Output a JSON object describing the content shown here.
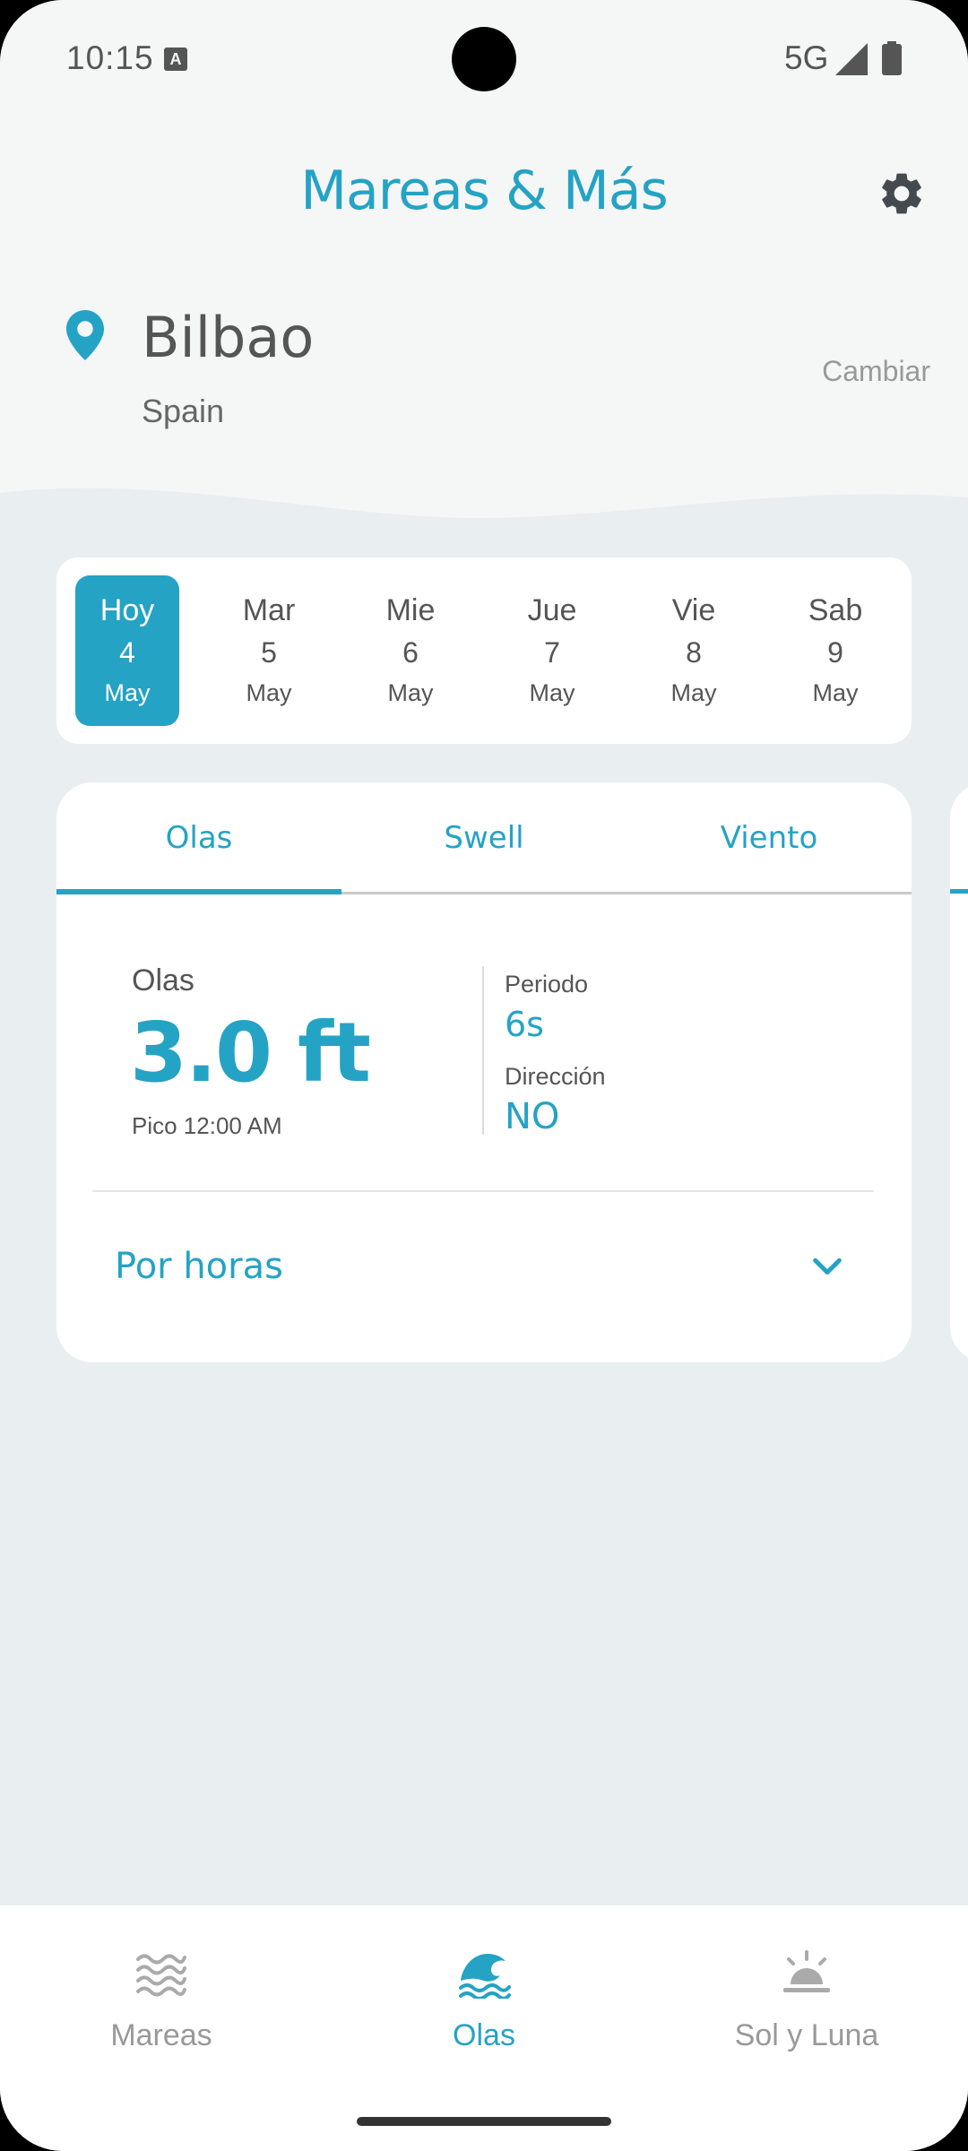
{
  "status_bar": {
    "time": "10:15",
    "network": "5G"
  },
  "header": {
    "title": "Mareas & Más"
  },
  "location": {
    "city": "Bilbao",
    "country": "Spain",
    "change_label": "Cambiar"
  },
  "dates": [
    {
      "day": "Hoy",
      "num": "4",
      "month": "May",
      "active": true
    },
    {
      "day": "Mar",
      "num": "5",
      "month": "May"
    },
    {
      "day": "Mie",
      "num": "6",
      "month": "May"
    },
    {
      "day": "Jue",
      "num": "7",
      "month": "May"
    },
    {
      "day": "Vie",
      "num": "8",
      "month": "May"
    },
    {
      "day": "Sab",
      "num": "9",
      "month": "May"
    }
  ],
  "tabs": [
    {
      "label": "Olas",
      "active": true
    },
    {
      "label": "Swell"
    },
    {
      "label": "Viento"
    }
  ],
  "waves": {
    "label": "Olas",
    "height": "3.0 ft",
    "peak": "Pico 12:00 AM",
    "period_label": "Periodo",
    "period_value": "6s",
    "direction_label": "Dirección",
    "direction_value": "NO",
    "hourly_label": "Por horas"
  },
  "bottom_nav": [
    {
      "label": "Mareas",
      "icon": "waves-icon"
    },
    {
      "label": "Olas",
      "icon": "breaking-wave-icon",
      "active": true
    },
    {
      "label": "Sol y Luna",
      "icon": "sunrise-icon"
    }
  ],
  "colors": {
    "accent": "#24a3c5",
    "background": "#e9eef1",
    "header_bg": "#f5f6f6"
  }
}
